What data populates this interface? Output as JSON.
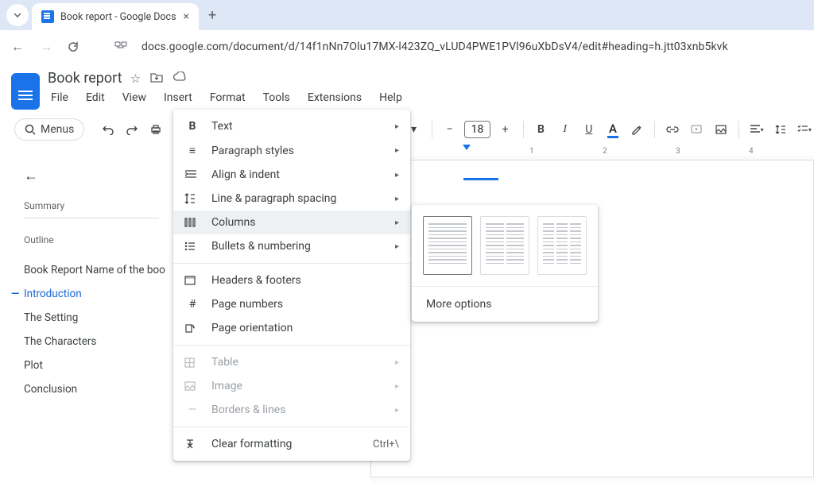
{
  "browser": {
    "tab_title": "Book report - Google Docs",
    "url": "docs.google.com/document/d/14f1nNn7Olu17MX-l423ZQ_vLUD4PWE1PVl96uXbDsV4/edit#heading=h.jtt03xnb5kvk"
  },
  "doc": {
    "title": "Book report",
    "menus": [
      "File",
      "Edit",
      "View",
      "Insert",
      "Format",
      "Tools",
      "Extensions",
      "Help"
    ],
    "search_label": "Menus",
    "font_size": "18"
  },
  "ruler": {
    "marks": [
      "1",
      "2",
      "3",
      "4"
    ]
  },
  "sidebar": {
    "summary_label": "Summary",
    "outline_label": "Outline",
    "items": [
      "Book Report Name of the boo",
      "Introduction",
      "The Setting",
      "The Characters",
      "Plot",
      "Conclusion"
    ]
  },
  "format_menu": {
    "items": [
      {
        "label": "Text",
        "icon": "B",
        "submenu": true
      },
      {
        "label": "Paragraph styles",
        "icon": "≡",
        "submenu": true
      },
      {
        "label": "Align & indent",
        "icon": "⇥",
        "submenu": true
      },
      {
        "label": "Line & paragraph spacing",
        "icon": "↕",
        "submenu": true
      },
      {
        "label": "Columns",
        "icon": "⫼",
        "submenu": true,
        "highlighted": true
      },
      {
        "label": "Bullets & numbering",
        "icon": "≔",
        "submenu": true
      }
    ],
    "items2": [
      {
        "label": "Headers & footers",
        "icon": "▭"
      },
      {
        "label": "Page numbers",
        "icon": "#"
      },
      {
        "label": "Page orientation",
        "icon": "⟳"
      }
    ],
    "items3": [
      {
        "label": "Table",
        "icon": "⊞",
        "submenu": true,
        "disabled": true
      },
      {
        "label": "Image",
        "icon": "▣",
        "submenu": true,
        "disabled": true
      },
      {
        "label": "Borders & lines",
        "icon": "—",
        "submenu": true,
        "disabled": true
      }
    ],
    "clear": {
      "label": "Clear formatting",
      "icon": "✗",
      "shortcut": "Ctrl+\\"
    }
  },
  "columns_submenu": {
    "more_options": "More options"
  }
}
